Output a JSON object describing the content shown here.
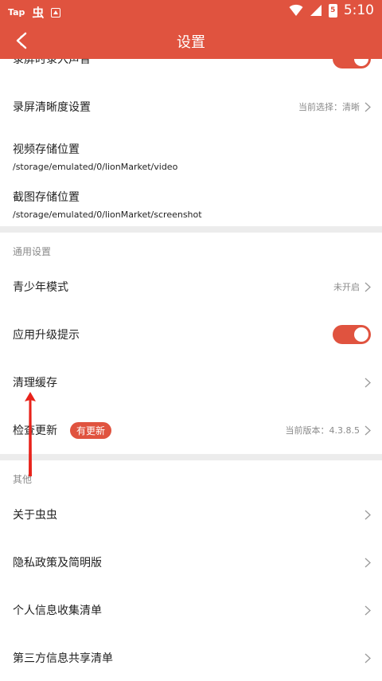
{
  "status_bar": {
    "tap_label": "Tap",
    "bug_glyph": "虫",
    "time": "5:10",
    "battery": "5",
    "icons": [
      "wifi-icon",
      "signal-icon",
      "battery-icon"
    ]
  },
  "app_bar": {
    "title": "设置",
    "back_icon": "back-icon"
  },
  "colors": {
    "accent": "#e0533f",
    "text": "#222222",
    "muted": "#8a8a8a",
    "band": "#ececec"
  },
  "sections": {
    "record": {
      "record_audio": {
        "label": "录屏时录入声音",
        "enabled": true
      },
      "quality": {
        "label": "录屏清晰度设置",
        "value": "当前选择：清晰"
      },
      "video_path": {
        "label": "视频存储位置",
        "path": "/storage/emulated/0/lionMarket/video"
      },
      "screenshot_path": {
        "label": "截图存储位置",
        "path": "/storage/emulated/0/lionMarket/screenshot"
      }
    },
    "general": {
      "header": "通用设置",
      "teen_mode": {
        "label": "青少年模式",
        "value": "未开启"
      },
      "upgrade_prompt": {
        "label": "应用升级提示",
        "enabled": true
      },
      "clear_cache": {
        "label": "清理缓存"
      },
      "check_update": {
        "label": "检查更新",
        "badge": "有更新",
        "value": "当前版本：4.3.8.5"
      }
    },
    "other": {
      "header": "其他",
      "about": {
        "label": "关于虫虫"
      },
      "privacy": {
        "label": "隐私政策及简明版"
      },
      "personal_info": {
        "label": "个人信息收集清单"
      },
      "third_party": {
        "label": "第三方信息共享清单"
      }
    }
  }
}
